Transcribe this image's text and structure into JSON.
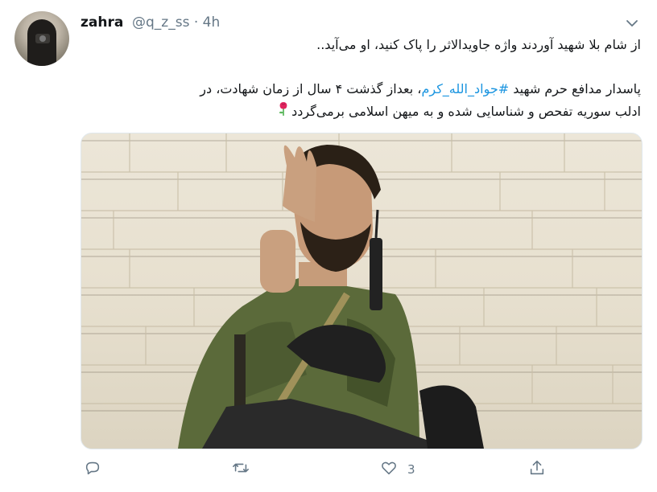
{
  "tweet": {
    "author_name": "zahra",
    "handle_time": "@q_z_ss · 4h",
    "line1": "از شام بلا شهید آوردند واژه جاویدالاثر را پاک کنید، او می‌آید..",
    "line2_pre": "پاسدار مدافع حرم شهید ",
    "hashtag": "#جواد_الله_کرم",
    "line2_post": "، بعداز گذشت ۴ سال از زمان شهادت، در",
    "line3": "ادلب سوریه تفحص و شناسایی شده و به میهن اسلامی برمی‌گردد",
    "emoji": "rose-icon",
    "likes_count": "3"
  },
  "icons": {
    "menu": "chevron-down-icon",
    "reply": "reply-icon",
    "retweet": "retweet-icon",
    "like": "heart-icon",
    "share": "share-icon"
  },
  "colors": {
    "hashtag": "#1b95e0",
    "muted": "#657786",
    "text": "#14171a"
  }
}
